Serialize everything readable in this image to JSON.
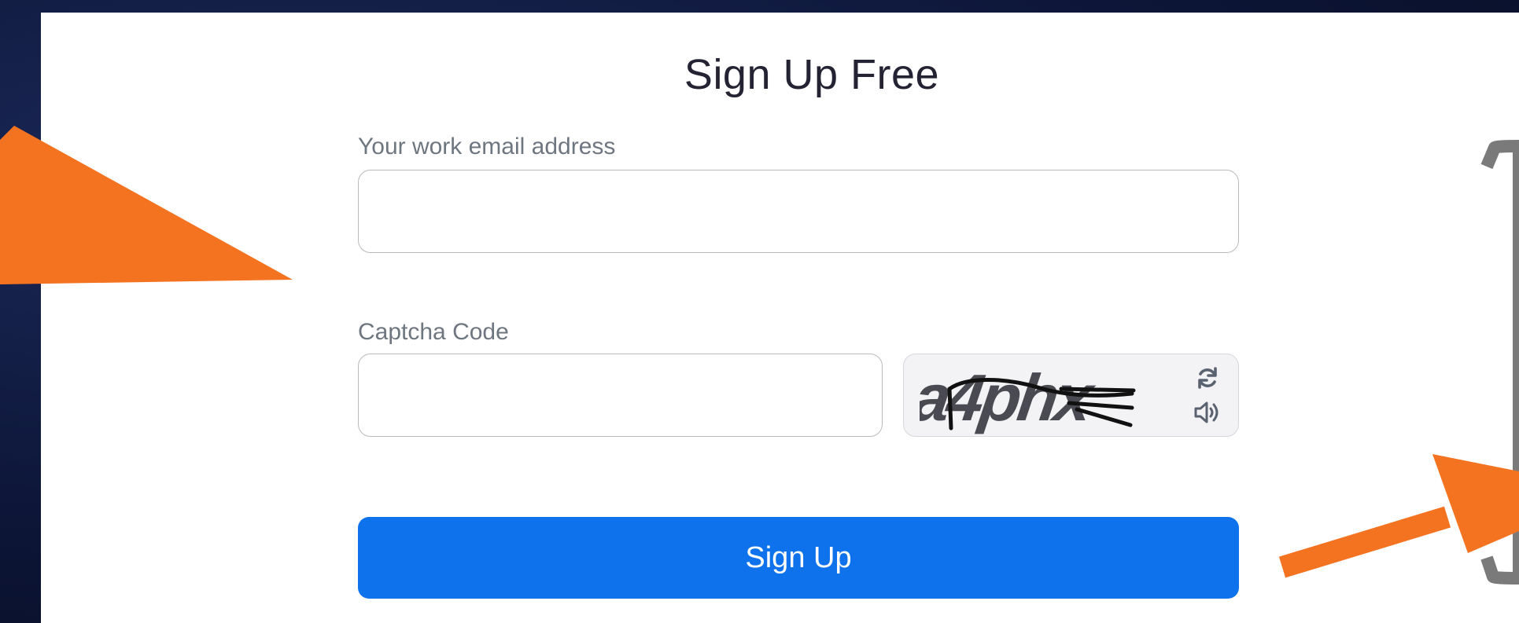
{
  "form": {
    "title": "Sign Up Free",
    "email": {
      "label": "Your work email address",
      "value": "",
      "placeholder": ""
    },
    "captcha": {
      "label": "Captcha Code",
      "value": "",
      "placeholder": "",
      "image_text": "a4phx",
      "refresh_icon": "refresh-icon",
      "audio_icon": "speaker-icon"
    },
    "submit_label": "Sign Up"
  },
  "colors": {
    "primary_button": "#0e72ed",
    "annotation_arrow": "#f47321",
    "annotation_box": "#7a7a7a",
    "background": "#0d1638"
  }
}
